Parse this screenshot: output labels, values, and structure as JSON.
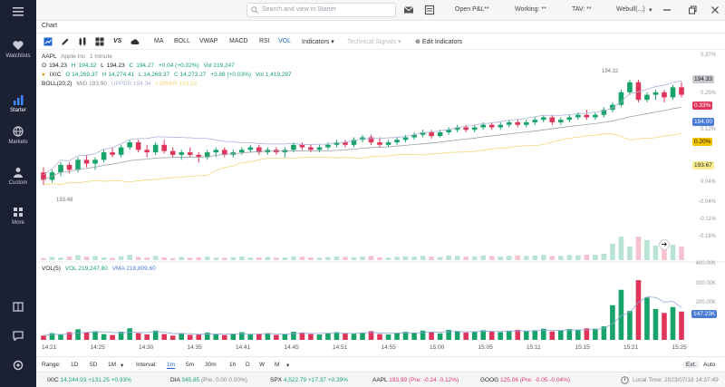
{
  "sidebar": {
    "items": [
      {
        "label": "Watchlists",
        "icon": "heart-icon"
      },
      {
        "label": "Starter",
        "icon": "bar-chart-icon"
      },
      {
        "label": "Markets",
        "icon": "globe-icon"
      },
      {
        "label": "Custom",
        "icon": "person-icon"
      },
      {
        "label": "More",
        "icon": "grid-icon"
      }
    ]
  },
  "topbar": {
    "search_placeholder": "Search and view in Starter",
    "open_pl": "Open P&L**",
    "working": "Working: **",
    "tav": "TAV: **",
    "account": "Webull(...)"
  },
  "tab": {
    "label": "Chart"
  },
  "toolbar": {
    "items": [
      "MA",
      "BOLL",
      "VWAP",
      "MACD",
      "RSI",
      "VOL"
    ],
    "indicators": "Indicators",
    "technical_signals": "Technical Signals",
    "edit_indicators": "Edit Indicators"
  },
  "symbol": {
    "ticker": "AAPL",
    "name": "Apple Inc",
    "interval": "1 minute"
  },
  "ohlc": {
    "o_label": "O",
    "o": "194.23",
    "h_label": "H",
    "h": "194.32",
    "l_label": "L",
    "l": "194.23",
    "c_label": "C",
    "c": "194.27",
    "chg": "+0.04 (+0.02%)",
    "vol": "Vol 219,247"
  },
  "ixic": {
    "label": "IXIC",
    "o": "O 14,269.37",
    "h": "H 14,274.41",
    "l": "L 14,269.37",
    "c": "C 14,273.27",
    "chg": "+3.88 (+0.03%)",
    "vol": "Vol 1,419,287"
  },
  "boll": {
    "label": "BOLL(20,2)",
    "mid": "MID 193.90",
    "upper": "UPPER 194.34",
    "lower": "LOWER 193.52"
  },
  "vol_legend": {
    "label": "VOL(5)",
    "vol": "VOL 219,247.80",
    "vma": "VMA 218,809.60"
  },
  "price_axis": {
    "labels": [
      "0.37%",
      "0.25%",
      "0.12%",
      "0.04%",
      "-0.04%",
      "-0.11%",
      "-0.18%"
    ],
    "current": "194.33",
    "pct_red": "0.33%",
    "mid": "194.00",
    "pct_yellow": "0.20%",
    "lower": "193.67",
    "high_marker": "194.32",
    "low_marker": "193.48"
  },
  "vol_axis": {
    "labels": [
      "400.00K",
      "300.00K",
      "200.00K",
      "100.00K"
    ],
    "current": "147.23K"
  },
  "time_labels": [
    "14:21",
    "14:25",
    "14:30",
    "14:35",
    "14:41",
    "14:45",
    "14:51",
    "14:55",
    "15:00",
    "15:05",
    "15:11",
    "15:15",
    "15:21",
    "15:25"
  ],
  "bottom": {
    "range_label": "Range:",
    "ranges": [
      "1D",
      "5D",
      "1M"
    ],
    "interval_label": "Interval:",
    "intervals": [
      "1m",
      "5m",
      "30m",
      "1h",
      "D",
      "W",
      "M"
    ],
    "ext": "Ext.",
    "auto": "Auto"
  },
  "status": {
    "tickers": [
      {
        "sym": "IXIC",
        "val": "14,244.93",
        "chg": "+131.25 +0.93%",
        "color": "#17a36a"
      },
      {
        "sym": "DIA",
        "val": "345.85",
        "chg": "(Pre: 0.00 0.00%)",
        "color": "#17a36a"
      },
      {
        "sym": "SPX",
        "val": "4,522.79",
        "chg": "+17.37 +0.39%",
        "color": "#17a36a"
      },
      {
        "sym": "AAPL",
        "val": "193.99",
        "chg": "(Pre: -0.24 -0.12%)",
        "color": "#e0355a"
      },
      {
        "sym": "GOOG",
        "val": "125.06",
        "chg": "(Pre: -0.05 -0.04%)",
        "color": "#e0355a"
      }
    ],
    "local_time": "Local Time: 2023/07/18 14:37:49"
  },
  "colors": {
    "up": "#17a36a",
    "down": "#e0355a",
    "accent": "#1f66d1",
    "sidebar": "#1b2033"
  },
  "chart_data": {
    "type": "candlestick",
    "symbol": "AAPL",
    "candles": [
      [
        193.58,
        193.62,
        193.48,
        193.52
      ],
      [
        193.52,
        193.6,
        193.5,
        193.58
      ],
      [
        193.58,
        193.66,
        193.55,
        193.64
      ],
      [
        193.64,
        193.66,
        193.57,
        193.6
      ],
      [
        193.6,
        193.7,
        193.58,
        193.68
      ],
      [
        193.68,
        193.72,
        193.62,
        193.65
      ],
      [
        193.65,
        193.7,
        193.6,
        193.68
      ],
      [
        193.68,
        193.76,
        193.66,
        193.74
      ],
      [
        193.74,
        193.78,
        193.7,
        193.72
      ],
      [
        193.72,
        193.8,
        193.7,
        193.78
      ],
      [
        193.78,
        193.84,
        193.76,
        193.82
      ],
      [
        193.82,
        193.84,
        193.74,
        193.76
      ],
      [
        193.76,
        193.8,
        193.7,
        193.74
      ],
      [
        193.74,
        193.82,
        193.72,
        193.8
      ],
      [
        193.8,
        193.84,
        193.73,
        193.75
      ],
      [
        193.75,
        193.78,
        193.7,
        193.72
      ],
      [
        193.72,
        193.76,
        193.68,
        193.74
      ],
      [
        193.74,
        193.78,
        193.7,
        193.72
      ],
      [
        193.72,
        193.74,
        193.66,
        193.7
      ],
      [
        193.7,
        193.76,
        193.68,
        193.74
      ],
      [
        193.74,
        193.78,
        193.7,
        193.76
      ],
      [
        193.76,
        193.78,
        193.7,
        193.72
      ],
      [
        193.72,
        193.76,
        193.7,
        193.74
      ],
      [
        193.74,
        193.78,
        193.72,
        193.76
      ],
      [
        193.76,
        193.8,
        193.74,
        193.78
      ],
      [
        193.78,
        193.8,
        193.72,
        193.74
      ],
      [
        193.74,
        193.78,
        193.72,
        193.76
      ],
      [
        193.76,
        193.78,
        193.72,
        193.74
      ],
      [
        193.74,
        193.78,
        193.7,
        193.76
      ],
      [
        193.76,
        193.82,
        193.74,
        193.8
      ],
      [
        193.8,
        193.82,
        193.76,
        193.78
      ],
      [
        193.78,
        193.8,
        193.74,
        193.76
      ],
      [
        193.76,
        193.8,
        193.74,
        193.78
      ],
      [
        193.78,
        193.82,
        193.76,
        193.8
      ],
      [
        193.8,
        193.84,
        193.78,
        193.82
      ],
      [
        193.82,
        193.84,
        193.78,
        193.8
      ],
      [
        193.8,
        193.86,
        193.78,
        193.84
      ],
      [
        193.84,
        193.88,
        193.82,
        193.86
      ],
      [
        193.86,
        193.88,
        193.8,
        193.82
      ],
      [
        193.82,
        193.86,
        193.78,
        193.8
      ],
      [
        193.8,
        193.84,
        193.78,
        193.82
      ],
      [
        193.82,
        193.86,
        193.8,
        193.84
      ],
      [
        193.84,
        193.88,
        193.82,
        193.86
      ],
      [
        193.86,
        193.9,
        193.84,
        193.88
      ],
      [
        193.88,
        193.92,
        193.86,
        193.9
      ],
      [
        193.9,
        193.92,
        193.85,
        193.87
      ],
      [
        193.87,
        193.92,
        193.86,
        193.9
      ],
      [
        193.9,
        193.94,
        193.88,
        193.92
      ],
      [
        193.92,
        193.96,
        193.9,
        193.94
      ],
      [
        193.94,
        193.96,
        193.9,
        193.92
      ],
      [
        193.92,
        193.96,
        193.9,
        193.94
      ],
      [
        193.94,
        193.98,
        193.92,
        193.96
      ],
      [
        193.96,
        193.98,
        193.92,
        193.94
      ],
      [
        193.94,
        193.98,
        193.92,
        193.96
      ],
      [
        193.96,
        194.0,
        193.94,
        193.98
      ],
      [
        193.98,
        194.0,
        193.94,
        193.96
      ],
      [
        193.96,
        194.0,
        193.94,
        193.98
      ],
      [
        193.98,
        194.02,
        193.96,
        194.0
      ],
      [
        194.0,
        194.04,
        193.98,
        194.02
      ],
      [
        194.02,
        194.04,
        193.96,
        193.98
      ],
      [
        193.98,
        194.02,
        193.96,
        194.0
      ],
      [
        194.0,
        194.04,
        193.98,
        194.02
      ],
      [
        194.02,
        194.06,
        194.0,
        194.04
      ],
      [
        194.04,
        194.08,
        194.0,
        194.02
      ],
      [
        194.02,
        194.06,
        194.0,
        194.04
      ],
      [
        194.04,
        194.1,
        194.02,
        194.08
      ],
      [
        194.08,
        194.14,
        194.06,
        194.12
      ],
      [
        194.12,
        194.24,
        194.1,
        194.22
      ],
      [
        194.22,
        194.32,
        194.2,
        194.3
      ],
      [
        194.3,
        194.32,
        194.14,
        194.16
      ],
      [
        194.16,
        194.22,
        194.14,
        194.2
      ],
      [
        194.2,
        194.24,
        194.16,
        194.22
      ],
      [
        194.22,
        194.24,
        194.14,
        194.18
      ],
      [
        194.18,
        194.28,
        194.16,
        194.26
      ],
      [
        194.26,
        194.3,
        194.18,
        194.2
      ]
    ],
    "volume_k": [
      22,
      35,
      28,
      40,
      55,
      38,
      45,
      30,
      25,
      42,
      60,
      35,
      28,
      48,
      30,
      22,
      35,
      26,
      30,
      38,
      28,
      25,
      32,
      40,
      28,
      30,
      35,
      26,
      30,
      42,
      38,
      30,
      28,
      34,
      40,
      36,
      32,
      38,
      45,
      30,
      28,
      36,
      42,
      38,
      48,
      40,
      34,
      52,
      46,
      38,
      42,
      50,
      44,
      40,
      48,
      52,
      46,
      50,
      58,
      44,
      48,
      56,
      52,
      60,
      58,
      70,
      180,
      260,
      150,
      310,
      220,
      160,
      140,
      170,
      147
    ],
    "ylim": [
      193.4,
      194.4
    ],
    "vol_ylim": [
      0,
      400
    ]
  }
}
